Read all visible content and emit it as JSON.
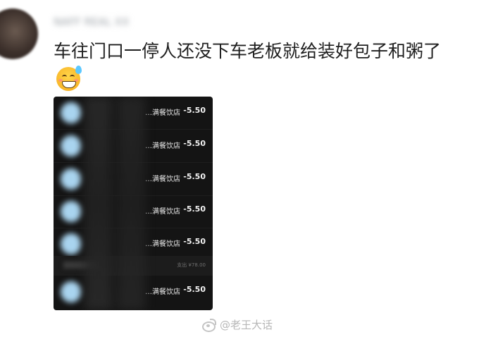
{
  "comment": {
    "username": "NAFF REAL XX",
    "text": "车往门口一停人还没下车老板就给装好包子和粥了",
    "emoji": "hot-face-emoji"
  },
  "payment_list": {
    "rows": [
      {
        "merchant": "…满餐饮店",
        "amount": "-5.50"
      },
      {
        "merchant": "…满餐饮店",
        "amount": "-5.50"
      },
      {
        "merchant": "…满餐饮店",
        "amount": "-5.50"
      },
      {
        "merchant": "…满餐饮店",
        "amount": "-5.50"
      },
      {
        "merchant": "…满餐饮店",
        "amount": "-5.50"
      }
    ],
    "summary_total": "支出 ¥78.00",
    "last_row": {
      "merchant": "…满餐饮店",
      "amount": "-5.50"
    }
  },
  "watermark": {
    "text": "@老王大话"
  },
  "colors": {
    "card_bg": "#141414",
    "text_main": "#1f1f1f",
    "watermark": "#b7b7b7"
  }
}
